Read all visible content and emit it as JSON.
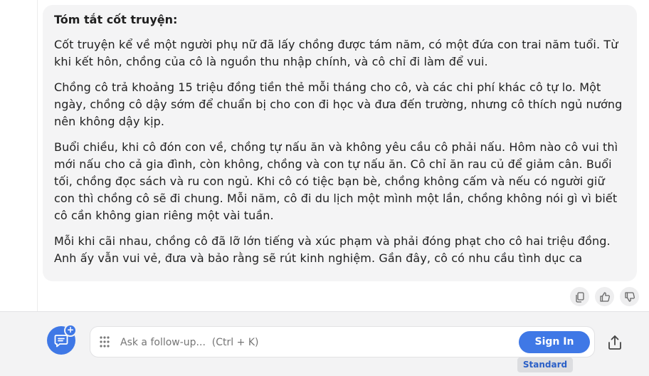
{
  "summary": {
    "title": "Tóm tắt cốt truyện:",
    "paragraphs": [
      "Cốt truyện kể về một người phụ nữ đã lấy chồng được tám năm, có một đứa con trai năm tuổi. Từ khi kết hôn, chồng của cô là nguồn thu nhập chính, và cô chỉ đi làm để vui.",
      "Chồng cô trả khoảng 15 triệu đồng tiền thẻ mỗi tháng cho cô, và các chi phí khác cô tự lo. Một ngày, chồng cô dậy sớm để chuẩn bị cho con đi học và đưa đến trường, nhưng cô thích ngủ nướng nên không dậy kịp.",
      "Buổi chiều, khi cô đón con về, chồng tự nấu ăn và không yêu cầu cô phải nấu. Hôm nào cô vui thì mới nấu cho cả gia đình, còn không, chồng và con tự nấu ăn. Cô chỉ ăn rau củ để giảm cân. Buổi tối, chồng đọc sách và ru con ngủ. Khi cô có tiệc bạn bè, chồng không cấm và nếu có người giữ con thì chồng cô sẽ đi chung. Mỗi năm, cô đi du lịch một mình một lần, chồng không nói gì vì biết cô cần không gian riêng một vài tuần.",
      "Mỗi khi cãi nhau, chồng cô đã lỡ lớn tiếng và xúc phạm và phải đóng phạt cho cô hai triệu đồng. Anh ấy vẫn vui vẻ, đưa và bảo rằng sẽ rút kinh nghiệm. Gần đây, cô có nhu cầu tình dục ca"
    ]
  },
  "feedback": {
    "icons": [
      "copy-icon",
      "thumbs-up-icon",
      "thumbs-down-icon"
    ]
  },
  "composer": {
    "placeholder": "Ask a follow-up...  (Ctrl + K)",
    "signin_label": "Sign In",
    "mode_label": "Standard"
  },
  "colors": {
    "accent": "#3f78e6",
    "card_bg": "#f4f4f5",
    "bar_bg": "#f3f3f4"
  }
}
